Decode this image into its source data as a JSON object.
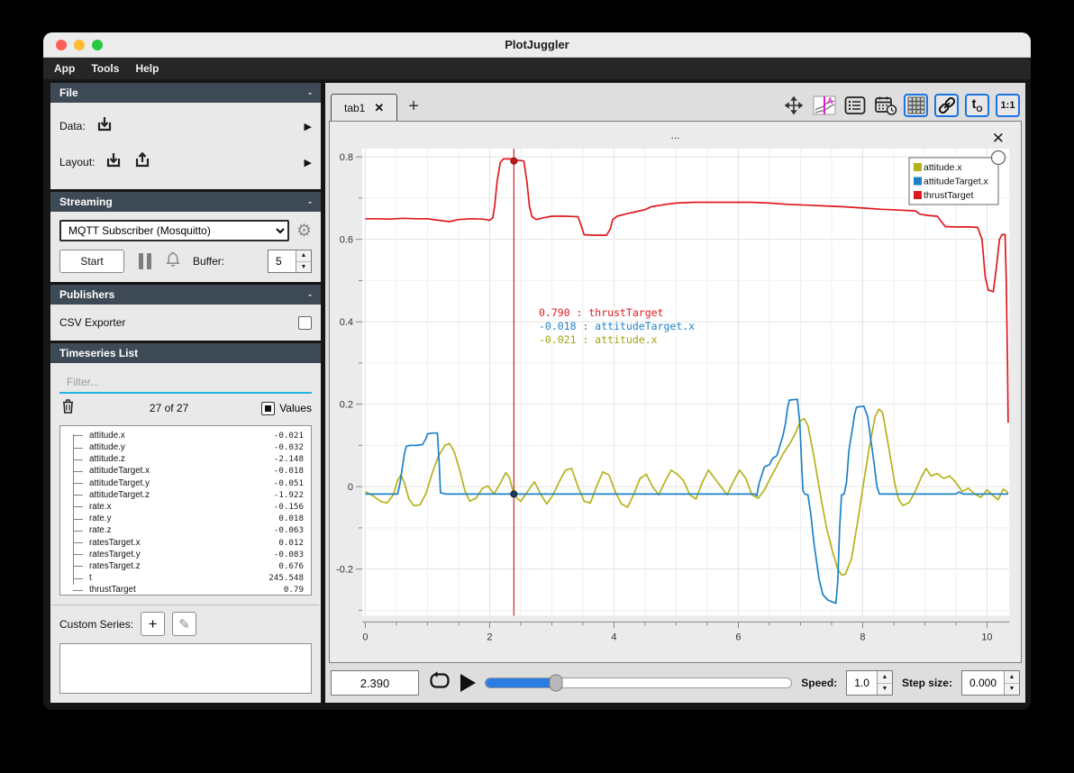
{
  "window": {
    "title": "PlotJuggler"
  },
  "menu": {
    "items": [
      "App",
      "Tools",
      "Help"
    ]
  },
  "colors": {
    "traffic_red": "#ff5f57",
    "traffic_yellow": "#febc2e",
    "traffic_green": "#28c840",
    "accent_blue": "#1a73e8",
    "filter_underline": "#23b2e4",
    "series_yellow": "#b5b21b",
    "series_blue": "#1e81c7",
    "series_red": "#e0191f"
  },
  "sidebar": {
    "file": {
      "header": "File",
      "collapse": "-",
      "data_label": "Data:",
      "layout_label": "Layout:"
    },
    "streaming": {
      "header": "Streaming",
      "collapse": "-",
      "source_selected": "MQTT Subscriber (Mosquitto)",
      "start_label": "Start",
      "buffer_label": "Buffer:",
      "buffer_value": "5"
    },
    "publishers": {
      "header": "Publishers",
      "collapse": "-",
      "csv_label": "CSV Exporter"
    },
    "timeseries": {
      "header": "Timeseries List",
      "filter_placeholder": "Filter...",
      "count": "27 of 27",
      "values_label": "Values",
      "custom_series_label": "Custom Series:",
      "add_label": "+",
      "edit_glyph": "✎",
      "items": [
        {
          "name": "attitude.x",
          "value": "-0.021"
        },
        {
          "name": "attitude.y",
          "value": "-0.032"
        },
        {
          "name": "attitude.z",
          "value": "-2.148"
        },
        {
          "name": "attitudeTarget.x",
          "value": "-0.018"
        },
        {
          "name": "attitudeTarget.y",
          "value": "-0.051"
        },
        {
          "name": "attitudeTarget.z",
          "value": "-1.922"
        },
        {
          "name": "rate.x",
          "value": "-0.156"
        },
        {
          "name": "rate.y",
          "value": "0.018"
        },
        {
          "name": "rate.z",
          "value": "-0.063"
        },
        {
          "name": "ratesTarget.x",
          "value": "0.012"
        },
        {
          "name": "ratesTarget.y",
          "value": "-0.083"
        },
        {
          "name": "ratesTarget.z",
          "value": "0.676"
        },
        {
          "name": "t",
          "value": "245.548"
        },
        {
          "name": "thrustTarget",
          "value": "0.79"
        }
      ]
    }
  },
  "tabs": {
    "active": "tab1",
    "close_glyph": "✕",
    "add_glyph": "+"
  },
  "plot": {
    "title": "...",
    "close_glyph": "✕"
  },
  "transport": {
    "time": "2.390",
    "speed_label": "Speed:",
    "speed": "1.0",
    "step_label": "Step size:",
    "step": "0.000"
  },
  "chart_data": {
    "type": "line",
    "title": "...",
    "xlabel": "",
    "ylabel": "",
    "xlim": [
      -0.05,
      10.36
    ],
    "ylim": [
      -0.313,
      0.82
    ],
    "xticks": [
      0,
      2,
      4,
      6,
      8,
      10
    ],
    "yticks": [
      -0.2,
      0,
      0.2,
      0.4,
      0.6,
      0.8
    ],
    "grid": true,
    "legend_position": "top-right",
    "cursor": {
      "t": 2.39,
      "tooltip": [
        {
          "text": " 0.790 : thrustTarget",
          "color": "#e0191f"
        },
        {
          "text": "-0.018 : attitudeTarget.x",
          "color": "#1e81c7"
        },
        {
          "text": "-0.021 : attitude.x",
          "color": "#a3a317"
        }
      ],
      "dots": [
        {
          "v": 0.79,
          "fill": "#c01818",
          "stroke": "#7a0f0f"
        },
        {
          "v": -0.018,
          "fill": "#1d3a57",
          "stroke": "#0e2339"
        }
      ]
    },
    "series": [
      {
        "name": "attitude.x",
        "color": "#b5b21b",
        "points": [
          [
            0,
            -0.012
          ],
          [
            0.12,
            -0.022
          ],
          [
            0.25,
            -0.036
          ],
          [
            0.35,
            -0.04
          ],
          [
            0.45,
            -0.02
          ],
          [
            0.52,
            0.015
          ],
          [
            0.57,
            0.028
          ],
          [
            0.63,
            0.01
          ],
          [
            0.7,
            -0.03
          ],
          [
            0.78,
            -0.046
          ],
          [
            0.88,
            -0.044
          ],
          [
            0.98,
            -0.015
          ],
          [
            1.08,
            0.035
          ],
          [
            1.18,
            0.075
          ],
          [
            1.28,
            0.1
          ],
          [
            1.35,
            0.105
          ],
          [
            1.43,
            0.085
          ],
          [
            1.52,
            0.04
          ],
          [
            1.6,
            -0.01
          ],
          [
            1.68,
            -0.035
          ],
          [
            1.78,
            -0.028
          ],
          [
            1.88,
            -0.005
          ],
          [
            1.97,
            0.002
          ],
          [
            2.07,
            -0.018
          ],
          [
            2.17,
            0.008
          ],
          [
            2.26,
            0.034
          ],
          [
            2.32,
            0.022
          ],
          [
            2.39,
            -0.021
          ],
          [
            2.5,
            -0.036
          ],
          [
            2.62,
            -0.01
          ],
          [
            2.72,
            0.012
          ],
          [
            2.82,
            -0.018
          ],
          [
            2.92,
            -0.042
          ],
          [
            3.02,
            -0.02
          ],
          [
            3.12,
            0.012
          ],
          [
            3.22,
            0.04
          ],
          [
            3.32,
            0.044
          ],
          [
            3.42,
            0
          ],
          [
            3.52,
            -0.035
          ],
          [
            3.62,
            -0.04
          ],
          [
            3.72,
            0
          ],
          [
            3.82,
            0.036
          ],
          [
            3.92,
            0.028
          ],
          [
            4.02,
            -0.012
          ],
          [
            4.12,
            -0.042
          ],
          [
            4.22,
            -0.05
          ],
          [
            4.32,
            -0.018
          ],
          [
            4.42,
            0.02
          ],
          [
            4.52,
            0.03
          ],
          [
            4.62,
            0
          ],
          [
            4.72,
            -0.02
          ],
          [
            4.82,
            0.012
          ],
          [
            4.92,
            0.04
          ],
          [
            5.02,
            0.03
          ],
          [
            5.12,
            0.014
          ],
          [
            5.22,
            -0.02
          ],
          [
            5.32,
            -0.03
          ],
          [
            5.42,
            0.01
          ],
          [
            5.52,
            0.04
          ],
          [
            5.62,
            0.02
          ],
          [
            5.72,
            0
          ],
          [
            5.82,
            -0.02
          ],
          [
            5.92,
            0.012
          ],
          [
            6.02,
            0.04
          ],
          [
            6.12,
            0.02
          ],
          [
            6.22,
            -0.02
          ],
          [
            6.32,
            -0.028
          ],
          [
            6.42,
            -0.008
          ],
          [
            6.52,
            0.022
          ],
          [
            6.62,
            0.05
          ],
          [
            6.72,
            0.08
          ],
          [
            6.82,
            0.102
          ],
          [
            6.92,
            0.13
          ],
          [
            7,
            0.16
          ],
          [
            7.06,
            0.165
          ],
          [
            7.12,
            0.148
          ],
          [
            7.22,
            0.07
          ],
          [
            7.32,
            -0.02
          ],
          [
            7.42,
            -0.1
          ],
          [
            7.52,
            -0.16
          ],
          [
            7.6,
            -0.2
          ],
          [
            7.66,
            -0.214
          ],
          [
            7.72,
            -0.213
          ],
          [
            7.82,
            -0.175
          ],
          [
            7.92,
            -0.085
          ],
          [
            8,
            -0.005
          ],
          [
            8.1,
            0.09
          ],
          [
            8.2,
            0.17
          ],
          [
            8.26,
            0.188
          ],
          [
            8.32,
            0.18
          ],
          [
            8.42,
            0.095
          ],
          [
            8.52,
            0.005
          ],
          [
            8.58,
            -0.032
          ],
          [
            8.65,
            -0.046
          ],
          [
            8.75,
            -0.038
          ],
          [
            8.85,
            -0.01
          ],
          [
            8.95,
            0.025
          ],
          [
            9.02,
            0.044
          ],
          [
            9.1,
            0.026
          ],
          [
            9.2,
            0.032
          ],
          [
            9.3,
            0.02
          ],
          [
            9.4,
            0.026
          ],
          [
            9.5,
            0.01
          ],
          [
            9.6,
            -0.012
          ],
          [
            9.7,
            -0.004
          ],
          [
            9.8,
            -0.018
          ],
          [
            9.9,
            -0.026
          ],
          [
            10,
            -0.008
          ],
          [
            10.1,
            -0.022
          ],
          [
            10.18,
            -0.032
          ],
          [
            10.26,
            -0.006
          ],
          [
            10.32,
            -0.012
          ],
          [
            10.34,
            -0.018
          ]
        ]
      },
      {
        "name": "attitudeTarget.x",
        "color": "#1e81c7",
        "points": [
          [
            0,
            -0.018
          ],
          [
            0.52,
            -0.018
          ],
          [
            0.56,
            0.01
          ],
          [
            0.6,
            0.05
          ],
          [
            0.63,
            0.08
          ],
          [
            0.66,
            0.098
          ],
          [
            0.72,
            0.1
          ],
          [
            0.82,
            0.1
          ],
          [
            0.92,
            0.102
          ],
          [
            0.97,
            0.115
          ],
          [
            1,
            0.128
          ],
          [
            1.08,
            0.13
          ],
          [
            1.16,
            0.13
          ],
          [
            1.19,
            0.05
          ],
          [
            1.21,
            -0.015
          ],
          [
            1.3,
            -0.018
          ],
          [
            2,
            -0.018
          ],
          [
            3,
            -0.018
          ],
          [
            4,
            -0.018
          ],
          [
            5,
            -0.018
          ],
          [
            6,
            -0.018
          ],
          [
            6.27,
            -0.018
          ],
          [
            6.3,
            -0.022
          ],
          [
            6.33,
            0.005
          ],
          [
            6.38,
            0.03
          ],
          [
            6.42,
            0.048
          ],
          [
            6.5,
            0.053
          ],
          [
            6.55,
            0.068
          ],
          [
            6.62,
            0.075
          ],
          [
            6.66,
            0.095
          ],
          [
            6.72,
            0.125
          ],
          [
            6.76,
            0.155
          ],
          [
            6.79,
            0.19
          ],
          [
            6.82,
            0.21
          ],
          [
            6.95,
            0.212
          ],
          [
            6.99,
            0.15
          ],
          [
            7.02,
            0.05
          ],
          [
            7.04,
            -0.01
          ],
          [
            7.07,
            -0.018
          ],
          [
            7.12,
            -0.02
          ],
          [
            7.16,
            -0.06
          ],
          [
            7.22,
            -0.14
          ],
          [
            7.3,
            -0.225
          ],
          [
            7.36,
            -0.262
          ],
          [
            7.44,
            -0.275
          ],
          [
            7.52,
            -0.28
          ],
          [
            7.57,
            -0.283
          ],
          [
            7.6,
            -0.23
          ],
          [
            7.63,
            -0.1
          ],
          [
            7.66,
            -0.02
          ],
          [
            7.7,
            -0.018
          ],
          [
            7.74,
            0.01
          ],
          [
            7.78,
            0.09
          ],
          [
            7.83,
            0.135
          ],
          [
            7.87,
            0.175
          ],
          [
            7.9,
            0.193
          ],
          [
            8.02,
            0.195
          ],
          [
            8.08,
            0.17
          ],
          [
            8.13,
            0.115
          ],
          [
            8.18,
            0.06
          ],
          [
            8.23,
            0
          ],
          [
            8.27,
            -0.018
          ],
          [
            8.5,
            -0.018
          ],
          [
            9,
            -0.018
          ],
          [
            9.5,
            -0.018
          ],
          [
            9.55,
            -0.013
          ],
          [
            9.62,
            -0.018
          ],
          [
            10,
            -0.018
          ],
          [
            10.34,
            -0.018
          ]
        ]
      },
      {
        "name": "thrustTarget",
        "color": "#e0191f",
        "points": [
          [
            0,
            0.65
          ],
          [
            0.2,
            0.65
          ],
          [
            0.4,
            0.649
          ],
          [
            0.6,
            0.651
          ],
          [
            0.8,
            0.65
          ],
          [
            1,
            0.65
          ],
          [
            1.25,
            0.645
          ],
          [
            1.35,
            0.643
          ],
          [
            1.5,
            0.648
          ],
          [
            1.7,
            0.65
          ],
          [
            1.9,
            0.649
          ],
          [
            2,
            0.646
          ],
          [
            2.05,
            0.652
          ],
          [
            2.08,
            0.68
          ],
          [
            2.12,
            0.74
          ],
          [
            2.17,
            0.786
          ],
          [
            2.22,
            0.795
          ],
          [
            2.35,
            0.795
          ],
          [
            2.45,
            0.792
          ],
          [
            2.55,
            0.79
          ],
          [
            2.6,
            0.74
          ],
          [
            2.64,
            0.68
          ],
          [
            2.68,
            0.655
          ],
          [
            2.75,
            0.648
          ],
          [
            2.85,
            0.652
          ],
          [
            3,
            0.656
          ],
          [
            3.2,
            0.656
          ],
          [
            3.42,
            0.655
          ],
          [
            3.48,
            0.63
          ],
          [
            3.52,
            0.611
          ],
          [
            3.7,
            0.61
          ],
          [
            3.88,
            0.61
          ],
          [
            3.94,
            0.625
          ],
          [
            3.98,
            0.648
          ],
          [
            4.05,
            0.656
          ],
          [
            4.2,
            0.662
          ],
          [
            4.35,
            0.667
          ],
          [
            4.5,
            0.672
          ],
          [
            4.6,
            0.679
          ],
          [
            4.8,
            0.684
          ],
          [
            5,
            0.688
          ],
          [
            5.3,
            0.69
          ],
          [
            5.6,
            0.69
          ],
          [
            5.9,
            0.69
          ],
          [
            6.2,
            0.69
          ],
          [
            6.5,
            0.688
          ],
          [
            6.8,
            0.685
          ],
          [
            7.1,
            0.683
          ],
          [
            7.4,
            0.681
          ],
          [
            7.7,
            0.679
          ],
          [
            8,
            0.676
          ],
          [
            8.3,
            0.673
          ],
          [
            8.6,
            0.671
          ],
          [
            8.85,
            0.669
          ],
          [
            8.92,
            0.661
          ],
          [
            9.05,
            0.658
          ],
          [
            9.2,
            0.656
          ],
          [
            9.28,
            0.64
          ],
          [
            9.33,
            0.631
          ],
          [
            9.5,
            0.63
          ],
          [
            9.7,
            0.63
          ],
          [
            9.85,
            0.629
          ],
          [
            9.92,
            0.6
          ],
          [
            9.97,
            0.51
          ],
          [
            10.02,
            0.477
          ],
          [
            10.1,
            0.473
          ],
          [
            10.15,
            0.53
          ],
          [
            10.2,
            0.6
          ],
          [
            10.24,
            0.611
          ],
          [
            10.29,
            0.612
          ],
          [
            10.31,
            0.5
          ],
          [
            10.33,
            0.3
          ],
          [
            10.34,
            0.155
          ]
        ]
      }
    ]
  }
}
